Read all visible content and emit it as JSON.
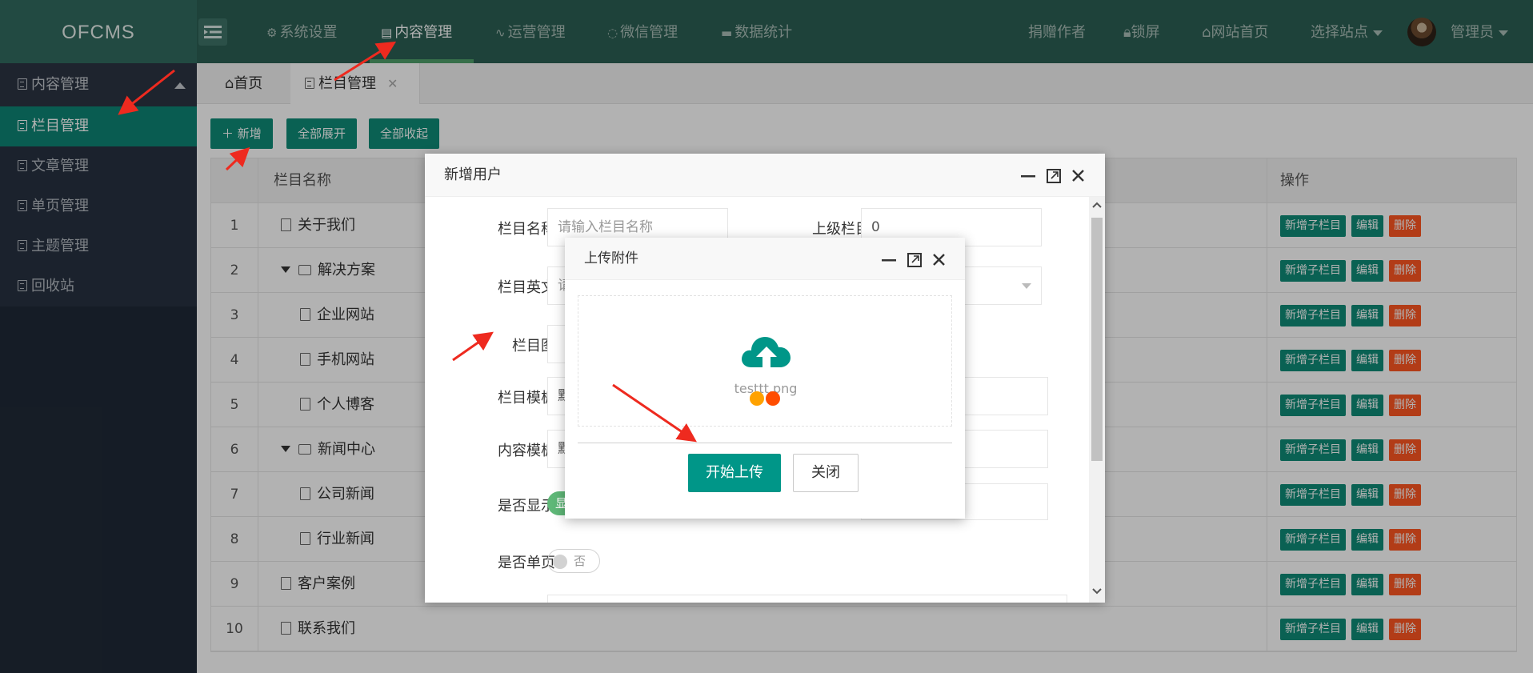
{
  "header": {
    "logo": "OFCMS",
    "nav": [
      {
        "label": "系统设置",
        "icon": "gear-icon"
      },
      {
        "label": "内容管理",
        "icon": "document-icon",
        "active": true
      },
      {
        "label": "运营管理",
        "icon": "pulse-icon"
      },
      {
        "label": "微信管理",
        "icon": "chat-icon"
      },
      {
        "label": "数据统计",
        "icon": "message-icon"
      }
    ],
    "right": {
      "donate": "捐赠作者",
      "lock": "锁屏",
      "site_home": "网站首页",
      "select_site": "选择站点",
      "user": "管理员"
    }
  },
  "sidebar": {
    "group": "内容管理",
    "items": [
      {
        "label": "栏目管理",
        "active": true
      },
      {
        "label": "文章管理"
      },
      {
        "label": "单页管理"
      },
      {
        "label": "主题管理"
      },
      {
        "label": "回收站"
      }
    ]
  },
  "tabs": {
    "home": "首页",
    "current": "栏目管理",
    "close": "✕"
  },
  "toolbar": {
    "add": "新增",
    "expand_all": "全部展开",
    "collapse_all": "全部收起"
  },
  "table": {
    "header_name": "栏目名称",
    "header_ops": "操作",
    "ops": {
      "add_child": "新增子栏目",
      "edit": "编辑",
      "delete": "删除"
    },
    "rows": [
      {
        "num": "1",
        "name": "关于我们",
        "level": 0,
        "type": "file"
      },
      {
        "num": "2",
        "name": "解决方案",
        "level": 0,
        "type": "folder"
      },
      {
        "num": "3",
        "name": "企业网站",
        "level": 1,
        "type": "file"
      },
      {
        "num": "4",
        "name": "手机网站",
        "level": 1,
        "type": "file"
      },
      {
        "num": "5",
        "name": "个人博客",
        "level": 1,
        "type": "file"
      },
      {
        "num": "6",
        "name": "新闻中心",
        "level": 0,
        "type": "folder"
      },
      {
        "num": "7",
        "name": "公司新闻",
        "level": 1,
        "type": "file"
      },
      {
        "num": "8",
        "name": "行业新闻",
        "level": 1,
        "type": "file"
      },
      {
        "num": "9",
        "name": "客户案例",
        "level": 0,
        "type": "file"
      },
      {
        "num": "10",
        "name": "联系我们",
        "level": 0,
        "type": "file"
      }
    ]
  },
  "add_dialog": {
    "title": "新增用户",
    "fields": {
      "name_label": "栏目名称",
      "name_placeholder": "请输入栏目名称",
      "parent_label": "上级栏目",
      "parent_value": "0",
      "english_label": "栏目英文",
      "english_placeholder": "请",
      "image_label": "栏目图",
      "template_label": "栏目模板",
      "template_value": "默",
      "content_template_label": "内容模板",
      "content_template_value": "默",
      "show_label": "是否显示",
      "show_value": "显",
      "single_label": "是否单页",
      "single_value": "否"
    }
  },
  "upload_dialog": {
    "title": "上传附件",
    "filename": "testtt.png",
    "start_upload": "开始上传",
    "close": "关闭"
  },
  "colors": {
    "header_bg": "#2b5f54",
    "sidebar_bg": "#1f2937",
    "accent": "#009688",
    "danger": "#ff5722",
    "annotation_arrow": "#ee2a1f"
  }
}
